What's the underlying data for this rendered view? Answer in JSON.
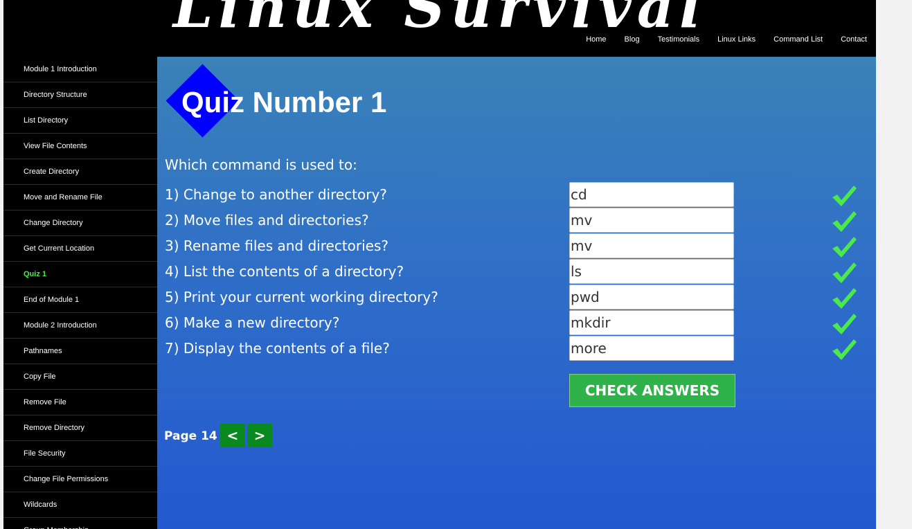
{
  "site": {
    "title": "Linux Survival"
  },
  "topnav": [
    "Home",
    "Blog",
    "Testimonials",
    "Linux Links",
    "Command List",
    "Contact"
  ],
  "sidebar": {
    "active": "Quiz 1",
    "items": [
      "Module 1 Introduction",
      "Directory Structure",
      "List Directory",
      "View File Contents",
      "Create Directory",
      "Move and Rename File",
      "Change Directory",
      "Get Current Location",
      "Quiz 1",
      "End of Module 1",
      "Module 2 Introduction",
      "Pathnames",
      "Copy File",
      "Remove File",
      "Remove Directory",
      "File Security",
      "Change File Permissions",
      "Wildcards",
      "Group Membership"
    ]
  },
  "quiz": {
    "title": "Quiz Number 1",
    "intro": "Which command is used to:",
    "questions": [
      {
        "text": "1) Change to another directory?",
        "answer": "cd",
        "correct": true
      },
      {
        "text": "2) Move files and directories?",
        "answer": "mv",
        "correct": true
      },
      {
        "text": "3) Rename files and directories?",
        "answer": "mv",
        "correct": true
      },
      {
        "text": "4) List the contents of a directory?",
        "answer": "ls",
        "correct": true
      },
      {
        "text": "5) Print your current working directory?",
        "answer": "pwd",
        "correct": true
      },
      {
        "text": "6) Make a new directory?",
        "answer": "mkdir",
        "correct": true
      },
      {
        "text": "7) Display the contents of a file?",
        "answer": "more",
        "correct": true
      }
    ],
    "check_label": "CHECK ANSWERS"
  },
  "pager": {
    "label": "Page 14",
    "prev": "<",
    "next": ">"
  },
  "colors": {
    "active_nav": "#4ae84a",
    "diamond": "#0000ff",
    "check_button": "#2fb24a",
    "pager_button": "#0a8a1e",
    "checkmark": "#4ce84c"
  },
  "icons": {
    "correct": "checkmark-icon",
    "diamond": "diamond-badge"
  }
}
